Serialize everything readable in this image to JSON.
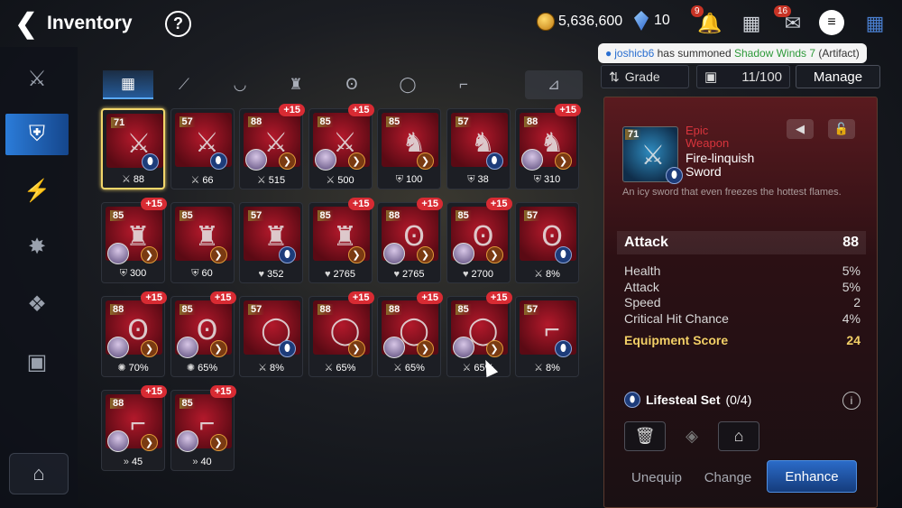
{
  "header": {
    "back_icon": "back-arrow-icon",
    "title": "Inventory",
    "help": "?"
  },
  "currency": {
    "gold": "5,636,600",
    "gems": "10"
  },
  "top_icons": [
    {
      "name": "notification-icon",
      "badge": "9"
    },
    {
      "name": "shop-icon",
      "badge": ""
    },
    {
      "name": "mail-icon",
      "badge": "16"
    },
    {
      "name": "chat-icon",
      "badge": ""
    },
    {
      "name": "menu-grid-icon",
      "badge": ""
    }
  ],
  "toast": {
    "user": "joshicb6",
    "middle": " has summoned ",
    "artifact": "Shadow Winds 7",
    "suffix": " (Artifact)"
  },
  "sidebar": [
    {
      "name": "sidebar-hero",
      "icon": "⚔"
    },
    {
      "name": "sidebar-equipment",
      "icon": "⛨",
      "active": true
    },
    {
      "name": "sidebar-artifact",
      "icon": "⚡"
    },
    {
      "name": "sidebar-catalyst",
      "icon": "✸"
    },
    {
      "name": "sidebar-material",
      "icon": "❖"
    },
    {
      "name": "sidebar-chest",
      "icon": "▣"
    },
    {
      "name": "sidebar-storage",
      "icon": "⌂"
    }
  ],
  "tabs": [
    {
      "name": "tab-all",
      "icon": "▦",
      "active": true
    },
    {
      "name": "tab-weapon",
      "icon": "⟋"
    },
    {
      "name": "tab-helmet",
      "icon": "◡"
    },
    {
      "name": "tab-armor",
      "icon": "♜"
    },
    {
      "name": "tab-necklace",
      "icon": "Ꙩ"
    },
    {
      "name": "tab-ring",
      "icon": "◯"
    },
    {
      "name": "tab-boots",
      "icon": "⌐"
    },
    {
      "name": "tab-filter",
      "icon": "⊿"
    }
  ],
  "items": [
    {
      "level": "71",
      "plus": "",
      "stat_icon": "⚔",
      "stat": "88",
      "hero": false,
      "set": "blue",
      "glyph": "⚔",
      "selected": true
    },
    {
      "level": "57",
      "plus": "",
      "stat_icon": "⚔",
      "stat": "66",
      "hero": false,
      "set": "blue",
      "glyph": "⚔"
    },
    {
      "level": "88",
      "plus": "+15",
      "stat_icon": "⚔",
      "stat": "515",
      "hero": true,
      "set": "gear",
      "glyph": "⚔"
    },
    {
      "level": "85",
      "plus": "+15",
      "stat_icon": "⚔",
      "stat": "500",
      "hero": true,
      "set": "gear",
      "glyph": "⚔"
    },
    {
      "level": "85",
      "plus": "",
      "stat_icon": "⛨",
      "stat": "100",
      "hero": false,
      "set": "gear",
      "glyph": "♞"
    },
    {
      "level": "57",
      "plus": "",
      "stat_icon": "⛨",
      "stat": "38",
      "hero": false,
      "set": "blue",
      "glyph": "♞"
    },
    {
      "level": "88",
      "plus": "+15",
      "stat_icon": "⛨",
      "stat": "310",
      "hero": true,
      "set": "gear",
      "glyph": "♞"
    },
    {
      "level": "85",
      "plus": "+15",
      "stat_icon": "⛨",
      "stat": "300",
      "hero": true,
      "set": "gear",
      "glyph": "♜"
    },
    {
      "level": "85",
      "plus": "",
      "stat_icon": "⛨",
      "stat": "60",
      "hero": false,
      "set": "gear",
      "glyph": "♜"
    },
    {
      "level": "57",
      "plus": "",
      "stat_icon": "♥",
      "stat": "352",
      "hero": false,
      "set": "blue",
      "glyph": "♜"
    },
    {
      "level": "85",
      "plus": "+15",
      "stat_icon": "♥",
      "stat": "2765",
      "hero": false,
      "set": "gear",
      "glyph": "♜"
    },
    {
      "level": "88",
      "plus": "+15",
      "stat_icon": "♥",
      "stat": "2765",
      "hero": true,
      "set": "gear",
      "glyph": "Ꙩ"
    },
    {
      "level": "85",
      "plus": "+15",
      "stat_icon": "♥",
      "stat": "2700",
      "hero": true,
      "set": "gear",
      "glyph": "Ꙩ"
    },
    {
      "level": "57",
      "plus": "",
      "stat_icon": "⚔",
      "stat": "8%",
      "hero": false,
      "set": "blue",
      "glyph": "Ꙩ"
    },
    {
      "level": "88",
      "plus": "+15",
      "stat_icon": "✺",
      "stat": "70%",
      "hero": true,
      "set": "gear",
      "glyph": "Ꙩ"
    },
    {
      "level": "85",
      "plus": "+15",
      "stat_icon": "✺",
      "stat": "65%",
      "hero": true,
      "set": "gear",
      "glyph": "Ꙩ"
    },
    {
      "level": "57",
      "plus": "",
      "stat_icon": "⚔",
      "stat": "8%",
      "hero": false,
      "set": "blue",
      "glyph": "◯"
    },
    {
      "level": "88",
      "plus": "+15",
      "stat_icon": "⚔",
      "stat": "65%",
      "hero": false,
      "set": "gear",
      "glyph": "◯"
    },
    {
      "level": "88",
      "plus": "+15",
      "stat_icon": "⚔",
      "stat": "65%",
      "hero": true,
      "set": "gear",
      "glyph": "◯"
    },
    {
      "level": "85",
      "plus": "+15",
      "stat_icon": "⚔",
      "stat": "65%",
      "hero": true,
      "set": "gear",
      "glyph": "◯"
    },
    {
      "level": "57",
      "plus": "",
      "stat_icon": "⚔",
      "stat": "8%",
      "hero": false,
      "set": "blue",
      "glyph": "⌐"
    },
    {
      "level": "88",
      "plus": "+15",
      "stat_icon": "»",
      "stat": "45",
      "hero": true,
      "set": "gear",
      "glyph": "⌐"
    },
    {
      "level": "85",
      "plus": "+15",
      "stat_icon": "»",
      "stat": "40",
      "hero": true,
      "set": "gear",
      "glyph": "⌐"
    }
  ],
  "panel_top": {
    "grade_label": "Grade",
    "capacity": "11/100",
    "manage": "Manage"
  },
  "detail": {
    "level": "71",
    "rarity_line1": "Epic",
    "rarity_line2": "Weapon",
    "name_line1": "Fire-linquish",
    "name_line2": "Sword",
    "description": "An icy sword that even freezes the hottest flames.",
    "main_stat": {
      "label": "Attack",
      "value": "88"
    },
    "substats": [
      {
        "label": "Health",
        "value": "5%"
      },
      {
        "label": "Attack",
        "value": "5%"
      },
      {
        "label": "Speed",
        "value": "2"
      },
      {
        "label": "Critical Hit Chance",
        "value": "4%"
      }
    ],
    "score_label": "Equipment Score",
    "score_value": "24",
    "set_name": "Lifesteal Set",
    "set_count": "(0/4)",
    "buttons": {
      "unequip": "Unequip",
      "change": "Change",
      "enhance": "Enhance"
    }
  }
}
